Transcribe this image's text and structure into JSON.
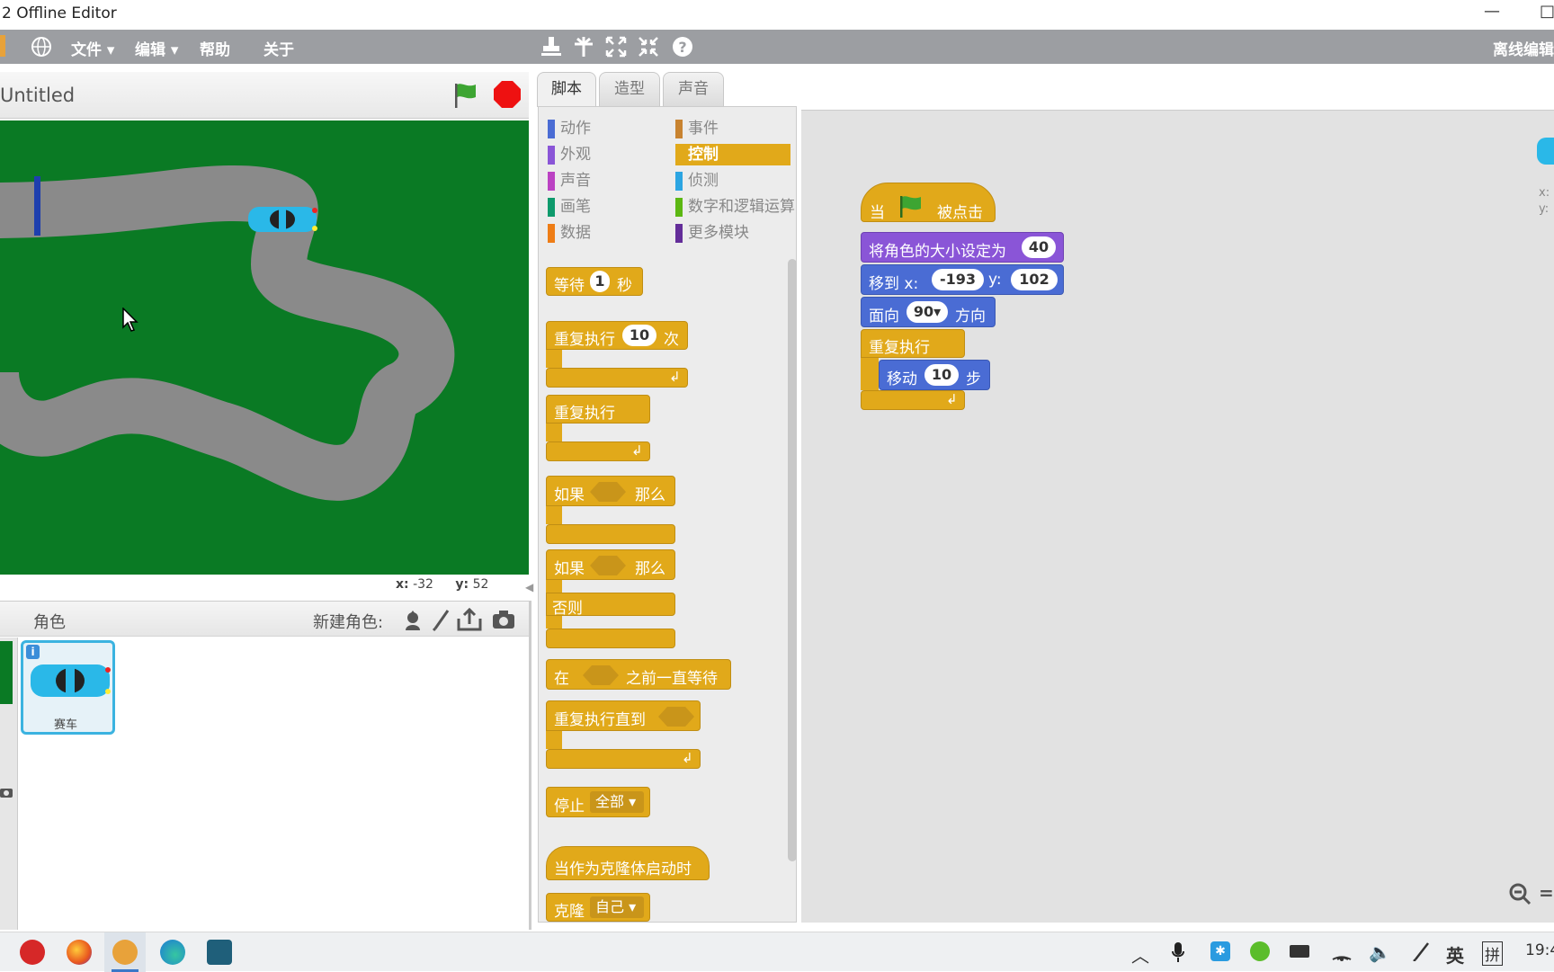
{
  "window": {
    "title": "2 Offline Editor",
    "minimize": "—",
    "maximize": "□"
  },
  "menubar": {
    "items": [
      "文件 ▾",
      "编辑 ▾",
      "帮助",
      "关于"
    ],
    "right_label": "离线编辑",
    "tool_icons": [
      "stamp-icon",
      "cut-icon",
      "grow-icon",
      "shrink-icon",
      "help-icon"
    ]
  },
  "stage": {
    "project_title": "Untitled",
    "coords_x_label": "x:",
    "coords_x": "-32",
    "coords_y_label": "y:",
    "coords_y": "52"
  },
  "sprites": {
    "header": "角色",
    "new_sprite_label": "新建角色:",
    "list": [
      {
        "name": "赛车"
      }
    ]
  },
  "tabs": [
    "脚本",
    "造型",
    "声音"
  ],
  "categories": [
    {
      "label": "动作",
      "color": "#4a6cd4"
    },
    {
      "label": "事件",
      "color": "#c88330"
    },
    {
      "label": "外观",
      "color": "#8a55d7"
    },
    {
      "label": "控制",
      "color": "#e1a91a"
    },
    {
      "label": "声音",
      "color": "#bb42c3"
    },
    {
      "label": "侦测",
      "color": "#2ca5e2"
    },
    {
      "label": "画笔",
      "color": "#0e9a6c"
    },
    {
      "label": "数字和逻辑运算",
      "color": "#5cb712"
    },
    {
      "label": "数据",
      "color": "#ee7d16"
    },
    {
      "label": "更多模块",
      "color": "#632d99"
    }
  ],
  "palette_blocks": {
    "wait": {
      "label": "等待",
      "value": "1",
      "unit": "秒"
    },
    "repeat": {
      "label": "重复执行",
      "value": "10",
      "unit": "次"
    },
    "forever": {
      "label": "重复执行"
    },
    "if_then": {
      "label": "如果",
      "then": "那么"
    },
    "if_else": {
      "label": "如果",
      "then": "那么",
      "else": "否则"
    },
    "wait_until": {
      "label": "在",
      "suffix": "之前一直等待"
    },
    "repeat_until": {
      "label": "重复执行直到"
    },
    "stop": {
      "label": "停止",
      "option": "全部"
    },
    "clone_start": {
      "label": "当作为克隆体启动时"
    },
    "clone": {
      "label": "克隆",
      "option": "自己"
    }
  },
  "script": {
    "hat": {
      "prefix": "当",
      "suffix": "被点击"
    },
    "set_size": {
      "label": "将角色的大小设定为",
      "value": "40"
    },
    "goto": {
      "label": "移到 x:",
      "x": "-193",
      "y_label": "y:",
      "y": "102"
    },
    "point": {
      "label": "面向",
      "value": "90",
      "suffix": "方向"
    },
    "forever": {
      "label": "重复执行"
    },
    "move": {
      "label": "移动",
      "value": "10",
      "unit": "步"
    }
  },
  "sprite_info": {
    "x_label": "x:",
    "y_label": "y:"
  },
  "taskbar": {
    "clock": "19:4",
    "lang": "英",
    "ime": "拼"
  }
}
